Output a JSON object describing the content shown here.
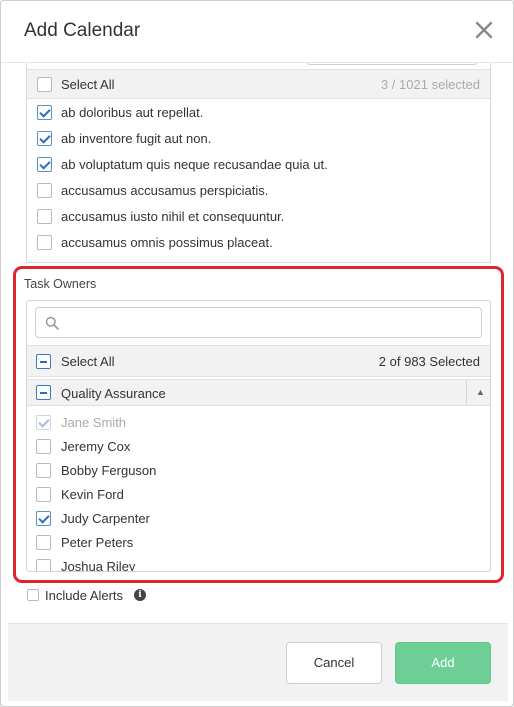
{
  "modal": {
    "title": "Add Calendar",
    "close_icon": "close-icon"
  },
  "top_list": {
    "select_all_label": "Select All",
    "selected_count": "3 / 1021 selected",
    "items": [
      {
        "label": "ab doloribus aut repellat.",
        "checked": true
      },
      {
        "label": "ab inventore fugit aut non.",
        "checked": true
      },
      {
        "label": "ab voluptatum quis neque recusandae quia ut.",
        "checked": true
      },
      {
        "label": "accusamus accusamus perspiciatis.",
        "checked": false
      },
      {
        "label": "accusamus iusto nihil et consequuntur.",
        "checked": false
      },
      {
        "label": "accusamus omnis possimus placeat.",
        "checked": false
      }
    ]
  },
  "task_owners": {
    "title": "Task Owners",
    "search": {
      "value": "",
      "placeholder": ""
    },
    "select_all_label": "Select All",
    "selected_count": "2 of 983 Selected",
    "group_label": "Quality Assurance",
    "items": [
      {
        "label": "Jane Smith",
        "checked": true,
        "disabled": true
      },
      {
        "label": "Jeremy Cox",
        "checked": false
      },
      {
        "label": "Bobby Ferguson",
        "checked": false
      },
      {
        "label": "Kevin Ford",
        "checked": false
      },
      {
        "label": "Judy Carpenter",
        "checked": true
      },
      {
        "label": "Peter Peters",
        "checked": false
      },
      {
        "label": "Joshua Riley",
        "checked": false
      }
    ]
  },
  "include_alerts": {
    "label": "Include Alerts",
    "checked": false
  },
  "footer": {
    "cancel_label": "Cancel",
    "add_label": "Add"
  },
  "colors": {
    "highlight": "#e0242b",
    "add_button": "#6dcf96",
    "checkbox_blue": "#2d6db5"
  }
}
